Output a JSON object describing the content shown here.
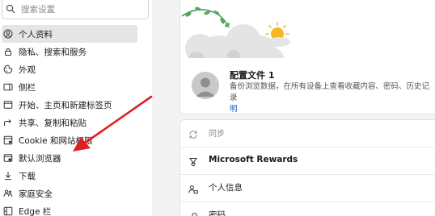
{
  "search": {
    "placeholder": "搜索设置",
    "icon": "search-icon"
  },
  "sidebar": {
    "items": [
      {
        "label": "个人资料",
        "icon": "profile-icon",
        "active": true
      },
      {
        "label": "隐私、搜索和服务",
        "icon": "lock-icon"
      },
      {
        "label": "外观",
        "icon": "appearance-icon"
      },
      {
        "label": "侧栏",
        "icon": "sidebar-icon"
      },
      {
        "label": "开始、主页和新建标签页",
        "icon": "home-icon"
      },
      {
        "label": "共享、复制和粘贴",
        "icon": "share-icon"
      },
      {
        "label": "Cookie 和网站权限",
        "icon": "cookie-icon"
      },
      {
        "label": "默认浏览器",
        "icon": "browser-icon"
      },
      {
        "label": "下载",
        "icon": "download-icon"
      },
      {
        "label": "家庭安全",
        "icon": "family-icon"
      },
      {
        "label": "Edge 栏",
        "icon": "edge-bar-icon"
      }
    ]
  },
  "profile": {
    "name": "配置文件 1",
    "description_main": "备份浏览数据，在所有设备上查看收藏内容、密码、历史记录",
    "description_link": "明"
  },
  "settings_rows": [
    {
      "label": "同步",
      "icon": "sync-icon",
      "muted": true
    },
    {
      "label": "Microsoft Rewards",
      "icon": "rewards-icon",
      "bold": true
    },
    {
      "label": "个人信息",
      "icon": "personal-info-icon"
    },
    {
      "label": "密码",
      "icon": "key-icon"
    }
  ],
  "annotation": {
    "color": "#e02020",
    "icon": "red-arrow"
  }
}
